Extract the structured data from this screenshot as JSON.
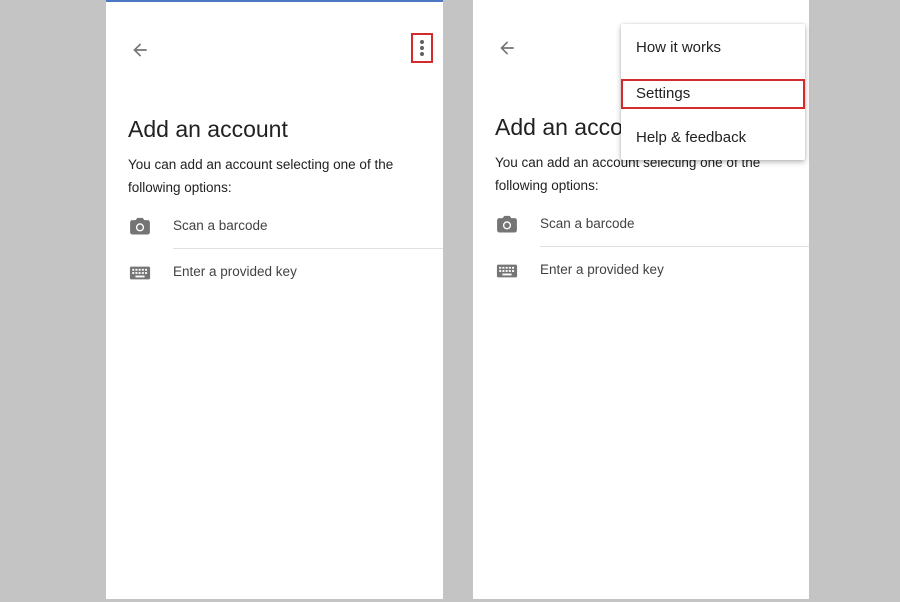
{
  "screens": {
    "left": {
      "title": "Add an account",
      "description": "You can add an account selecting one of the following options:",
      "options": [
        {
          "label": "Scan a barcode",
          "icon": "camera-icon"
        },
        {
          "label": "Enter a provided key",
          "icon": "keyboard-icon"
        }
      ]
    },
    "right": {
      "title": "Add an account",
      "description": "You can add an account selecting one of the following options:",
      "options": [
        {
          "label": "Scan a barcode",
          "icon": "camera-icon"
        },
        {
          "label": "Enter a provided key",
          "icon": "keyboard-icon"
        }
      ]
    }
  },
  "overflow_menu": {
    "items": [
      "How it works",
      "Settings",
      "Help & feedback"
    ],
    "highlighted": "Settings"
  },
  "colors": {
    "background": "#c4c4c4",
    "screen": "#ffffff",
    "highlight_border": "#d32b2b",
    "icon": "#757575",
    "text": "#212121"
  }
}
